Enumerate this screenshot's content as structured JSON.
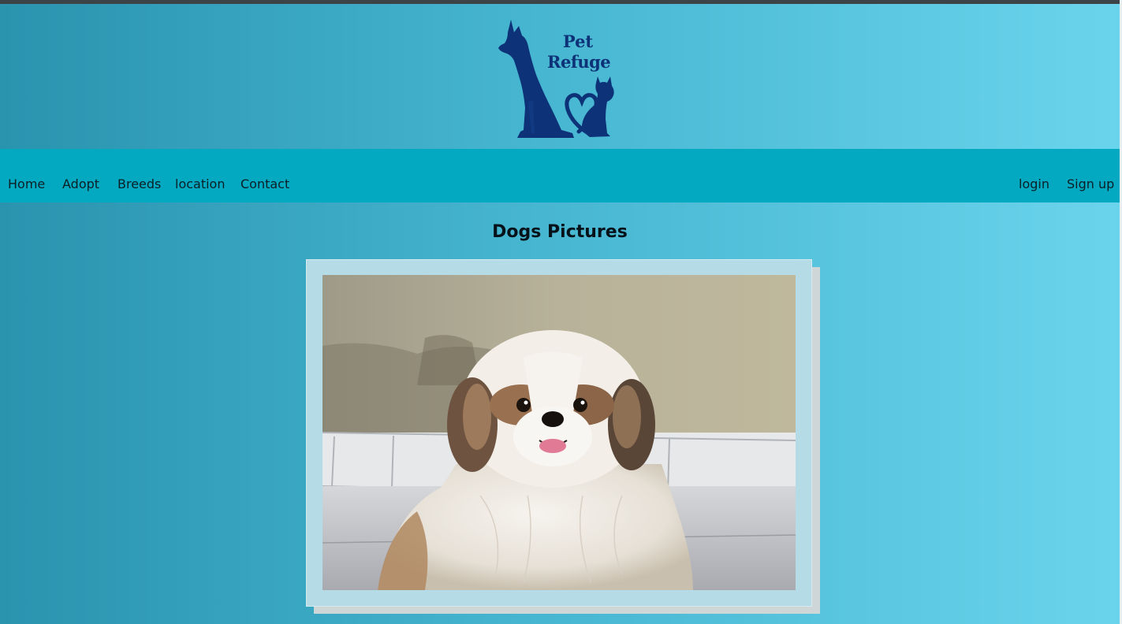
{
  "header": {
    "logo": {
      "line1": "Pet",
      "line2": "Refuge",
      "icon": "dog-and-cat-heart-logo",
      "color": "#0d3278"
    }
  },
  "nav": {
    "left": [
      "Home",
      "Adopt",
      "Breeds",
      "location",
      "Contact"
    ],
    "right": [
      "login",
      "Sign up"
    ]
  },
  "main": {
    "title": "Dogs Pictures",
    "photo": {
      "subject": "dog-photo"
    }
  },
  "colors": {
    "navbar": "#02a9c0",
    "background_start": "#2a93ae",
    "background_end": "#6ad4ec",
    "frame": "#b4dbe6",
    "frame_shadow": "#cfd6d8"
  }
}
